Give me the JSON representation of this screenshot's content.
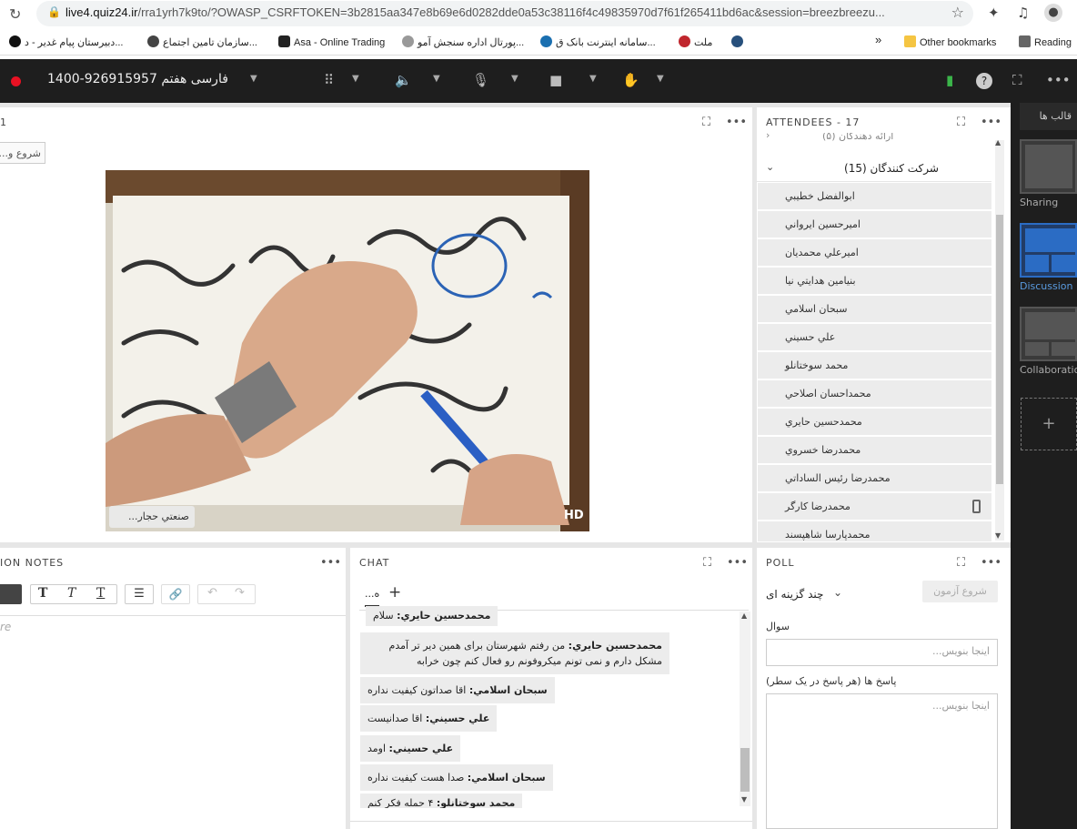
{
  "browser": {
    "url_host": "live4.quiz24.ir",
    "url_rest": "/rra1yrh7k9to/?OWASP_CSRFTOKEN=3b2815aa347e8b69e6d0282dde0a53c38116f4c49835970d7f61f265411bd6ac&session=breezbreezu...",
    "bookmarks": {
      "b1": "دبیرستان پیام غدیر - د...",
      "b2": "سازمان تامین اجتماع...",
      "b3": "Asa - Online Trading",
      "b4": "پورتال اداره سنجش آمو...",
      "b5": "سامانه اینترنت بانک ق...",
      "b6": "ملت",
      "more": "»",
      "other": "Other bookmarks",
      "reading": "Reading"
    }
  },
  "room": {
    "title": "فارسی هفتم 926915957-1400"
  },
  "share": {
    "start_button": "شروع و...",
    "presenter_tag": "صنعتي حجار...",
    "hd_badge": "HD",
    "pod_number": "1"
  },
  "attendees": {
    "title": "ATTENDEES",
    "count": "- 17",
    "hosts_group": "ارائه دهندگان (۵)",
    "participants_group": "شرکت کنندگان (15)",
    "list": [
      "ابوالفضل خطيبي",
      "اميرحسين ايرواني",
      "اميرعلي محمديان",
      "بنيامين هدايتي نيا",
      "سبحان اسلامي",
      "علي حسيني",
      "محمد سوختانلو",
      "محمداحسان اصلاحي",
      "محمدحسين حايري",
      "محمدرضا خسروي",
      "محمدرضا رئيس الساداتي",
      "محمدرضا كارگر",
      "محمدپارسا شاهپسند"
    ]
  },
  "notes": {
    "title": "ION NOTES",
    "placeholder": "re"
  },
  "chat": {
    "title": "CHAT",
    "tab": "ه...",
    "add": "+",
    "messages": [
      {
        "name": "محمدحسين حايري:",
        "text": " سلام"
      },
      {
        "name": "محمدحسين حايري:",
        "text": " من رفتم شهرستان براى همين دير تر آمدم",
        "text2": "مشكل دارم و نمى تونم ميكروفونم رو فعال كنم چون خرابه"
      },
      {
        "name": "سبحان اسلامي:",
        "text": " اقا صداتون كيفيت نداره"
      },
      {
        "name": "علي حسيني:",
        "text": " اقا صدانيست"
      },
      {
        "name": "علي حسيني:",
        "text": " اومد"
      },
      {
        "name": "سبحان اسلامي:",
        "text": " صدا هست كيفيت نداره"
      },
      {
        "name": "محمد سوختانلو:",
        "text": " ۴ حمله فكر كنم"
      }
    ]
  },
  "poll": {
    "title": "POLL",
    "type": "چند گزينه اى",
    "start_quiz": "شروع آزمون",
    "question_label": "سوال",
    "question_placeholder": "اینجا بنویس...",
    "answers_label": "پاسخ ها (هر پاسخ در یک سطر)",
    "answers_placeholder": "اینجا بنویس..."
  },
  "layouts": {
    "title": "قالب ها",
    "sharing": "Sharing",
    "discussion": "Discussion",
    "collaboration": "Collaboration",
    "add": "+"
  },
  "colors": {
    "accent": "#2b6cc4",
    "rec": "#e81123",
    "topbar": "#1e1e1e"
  }
}
